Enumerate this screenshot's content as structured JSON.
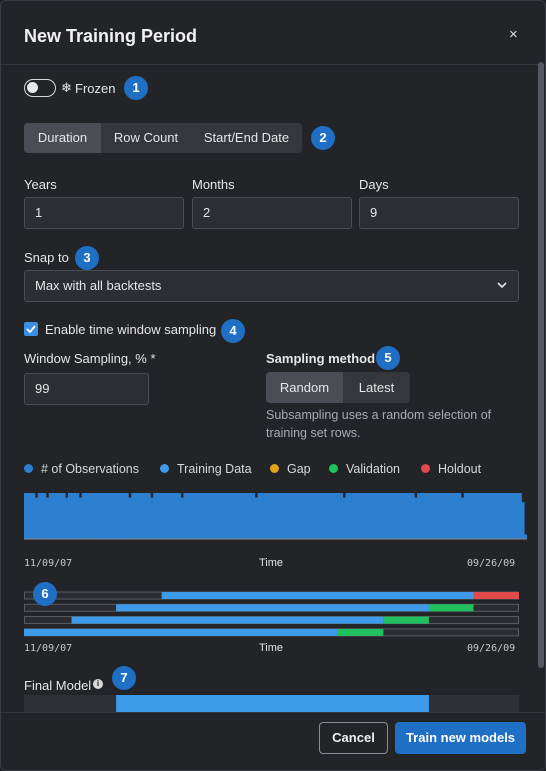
{
  "dialog": {
    "title": "New Training Period",
    "close_symbol": "×"
  },
  "markers": [
    "1",
    "2",
    "3",
    "4",
    "5",
    "6",
    "7"
  ],
  "frozen": {
    "label": "Frozen",
    "icon_glyph": "❄",
    "enabled": false
  },
  "window_type_tabs": [
    {
      "label": "Duration",
      "active": true
    },
    {
      "label": "Row Count",
      "active": false
    },
    {
      "label": "Start/End Date",
      "active": false
    }
  ],
  "duration": {
    "years_label": "Years",
    "years_value": "1",
    "months_label": "Months",
    "months_value": "2",
    "days_label": "Days",
    "days_value": "9"
  },
  "snap": {
    "label": "Snap to",
    "value": "Max with all backtests"
  },
  "sampling": {
    "checkbox_label": "Enable time window sampling",
    "checked": true,
    "percent_label": "Window Sampling, % *",
    "percent_value": "99",
    "method_label": "Sampling method",
    "methods": [
      {
        "label": "Random",
        "active": true
      },
      {
        "label": "Latest",
        "active": false
      }
    ],
    "help_text": "Subsampling uses a random selection of training set rows."
  },
  "legend": [
    {
      "label": "# of Observations",
      "color": "#2d7fd0"
    },
    {
      "label": "Training Data",
      "color": "#3d9be9"
    },
    {
      "label": "Gap",
      "color": "#e2a21a"
    },
    {
      "label": "Validation",
      "color": "#21c25e"
    },
    {
      "label": "Holdout",
      "color": "#e04a4a"
    }
  ],
  "observations_chart": {
    "x_start": "11/09/07",
    "x_end": "09/26/09",
    "x_label": "Time"
  },
  "backtests_chart": {
    "x_start": "11/09/07",
    "x_end": "09/26/09",
    "x_label": "Time"
  },
  "chart_data": [
    {
      "type": "bar",
      "xlabel": "Time",
      "x_range": [
        "11/09/07",
        "09/26/09"
      ],
      "values": [
        10,
        10,
        10,
        10,
        9,
        10,
        10,
        10,
        9,
        10,
        10,
        10,
        10,
        10,
        10,
        9,
        10,
        10,
        10,
        10,
        9,
        10,
        10,
        10,
        10,
        10,
        10,
        10,
        10,
        10,
        10,
        10,
        10,
        10,
        10,
        10,
        10,
        10,
        9,
        10,
        10,
        10,
        10,
        10,
        10,
        10,
        9,
        10,
        10,
        10,
        10,
        10,
        10,
        10,
        10,
        10,
        10,
        9,
        10,
        10,
        10,
        10,
        10,
        10,
        10,
        10,
        10,
        10,
        10,
        10,
        10,
        10,
        10,
        10,
        10,
        10,
        10,
        10,
        10,
        10,
        10,
        10,
        10,
        10,
        9,
        10,
        10,
        10,
        10,
        10,
        10,
        10,
        10,
        10,
        10,
        10,
        10,
        10,
        10,
        10,
        10,
        10,
        10,
        10,
        10,
        10,
        10,
        10,
        10,
        10,
        10,
        10,
        10,
        10,
        10,
        10,
        9,
        10,
        10,
        10,
        10,
        10,
        10,
        10,
        10,
        10,
        10,
        10,
        10,
        10,
        10,
        10,
        10,
        10,
        10,
        10,
        10,
        10,
        10,
        10,
        10,
        10,
        9,
        10,
        10,
        10,
        10,
        10,
        10,
        10,
        10,
        10,
        10,
        10,
        10,
        10,
        10,
        10,
        10,
        9,
        10,
        10,
        10,
        10,
        10,
        10,
        10,
        10,
        10,
        10,
        10,
        10,
        10,
        10,
        10,
        10,
        10,
        10,
        10,
        10,
        10,
        8,
        1
      ],
      "color": "#2d7fd0"
    },
    {
      "type": "timeline",
      "xlabel": "Time",
      "x_range": [
        "11/09/07",
        "09/26/09"
      ],
      "domain": [
        0,
        1
      ],
      "rows": [
        {
          "segments": [
            {
              "kind": "training",
              "from": 0.278,
              "to": 0.908
            },
            {
              "kind": "holdout",
              "from": 0.908,
              "to": 1.0
            }
          ]
        },
        {
          "segments": [
            {
              "kind": "training",
              "from": 0.186,
              "to": 0.818
            },
            {
              "kind": "validation",
              "from": 0.818,
              "to": 0.908
            }
          ]
        },
        {
          "segments": [
            {
              "kind": "training",
              "from": 0.096,
              "to": 0.726
            },
            {
              "kind": "validation",
              "from": 0.726,
              "to": 0.818
            }
          ]
        },
        {
          "segments": [
            {
              "kind": "training",
              "from": 0.0,
              "to": 0.634
            },
            {
              "kind": "validation",
              "from": 0.634,
              "to": 0.726
            }
          ]
        }
      ]
    }
  ],
  "final_model": {
    "label": "Final Model",
    "info_glyph": "i",
    "training_from": 0.186,
    "training_to": 0.818
  },
  "footer": {
    "cancel_label": "Cancel",
    "primary_label": "Train new models"
  }
}
